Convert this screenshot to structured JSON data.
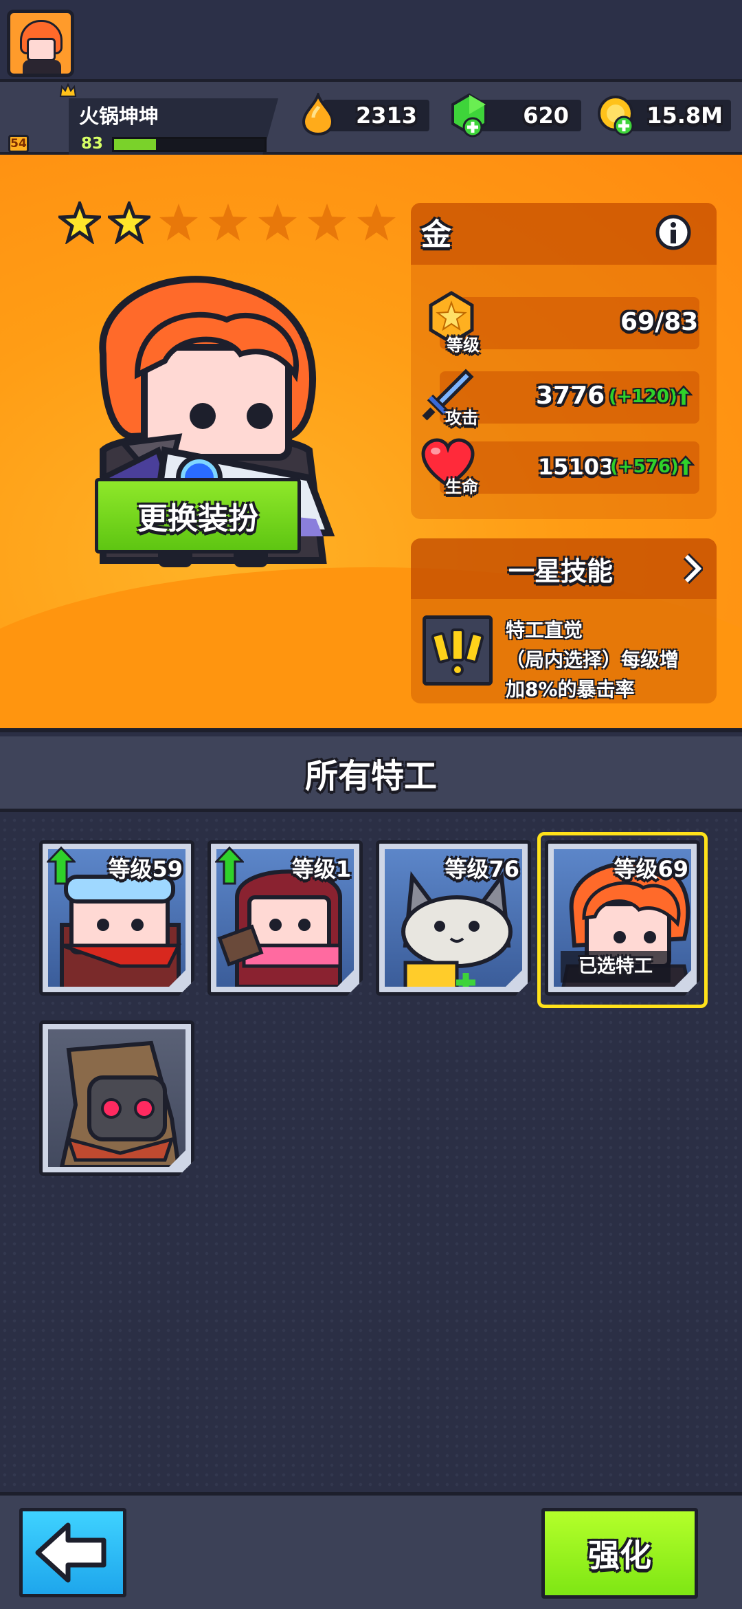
{
  "header": {
    "player_name": "火锅坤坤",
    "player_level": "83",
    "avatar_badge": "54",
    "xp_progress": 0.28,
    "resources": [
      {
        "icon": "flame-drop-icon",
        "value": "2313"
      },
      {
        "icon": "green-gem-icon",
        "value": "620"
      },
      {
        "icon": "gold-coin-icon",
        "value": "15.8M"
      }
    ]
  },
  "hero": {
    "stars_filled": 2,
    "stars_total": 7,
    "change_outfit_label": "更换装扮",
    "grade": "金",
    "stats": {
      "level_tag": "等级",
      "level_value": "69/83",
      "attack_tag": "攻击",
      "attack_value": "3776",
      "attack_bonus": "(+120)",
      "hp_tag": "生命",
      "hp_value": "15103",
      "hp_bonus": "(+576)"
    },
    "skill": {
      "title": "一星技能",
      "name": "特工直觉",
      "desc_line2": "（局内选择）每级增",
      "desc_line3": "加8%的暴击率"
    }
  },
  "agents": {
    "section_title": "所有特工",
    "cards": [
      {
        "level": "等级59",
        "upgrade": true
      },
      {
        "level": "等级1",
        "upgrade": true
      },
      {
        "level": "等级76",
        "upgrade": false
      },
      {
        "level": "等级69",
        "upgrade": false,
        "selected_label": "已选特工"
      }
    ]
  },
  "bottom": {
    "upgrade_label": "强化"
  },
  "colors": {
    "panel_orange": "#ff9d15",
    "confirm_green": "#7ee614",
    "back_blue": "#1ea6ec",
    "selected_yellow": "#ffe21a"
  }
}
